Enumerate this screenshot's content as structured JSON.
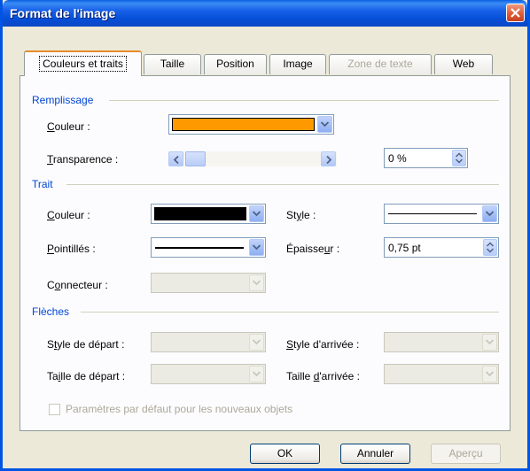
{
  "window": {
    "title": "Format de l'image"
  },
  "tabs": [
    {
      "label": "Couleurs et traits",
      "active": true
    },
    {
      "label": "Taille"
    },
    {
      "label": "Position"
    },
    {
      "label": "Image"
    },
    {
      "label": "Zone de texte",
      "disabled": true
    },
    {
      "label": "Web"
    }
  ],
  "fill": {
    "section": "Remplissage",
    "color_label": "Couleur :",
    "color_value": "#ff9900",
    "transparency_label": "Transparence :",
    "transparency_value": "0 %"
  },
  "line": {
    "section": "Trait",
    "color_label": "Couleur :",
    "color_value": "#000000",
    "style_label": "Style :",
    "dashed_label": "Pointillés :",
    "weight_label": "Épaisseur :",
    "weight_value": "0,75 pt",
    "connector_label": "Connecteur :"
  },
  "arrows": {
    "section": "Flèches",
    "begin_style_label": "Style de départ :",
    "end_style_label": "Style d'arrivée :",
    "begin_size_label": "Taille de départ :",
    "end_size_label": "Taille d'arrivée :"
  },
  "defaults_checkbox": "Paramètres par défaut pour les nouveaux objets",
  "buttons": {
    "ok": "OK",
    "cancel": "Annuler",
    "preview": "Aperçu"
  },
  "colors": {
    "titlebar": "#0a5ddf",
    "accent": "#0046d5",
    "dialog_bg": "#ece9d8"
  }
}
